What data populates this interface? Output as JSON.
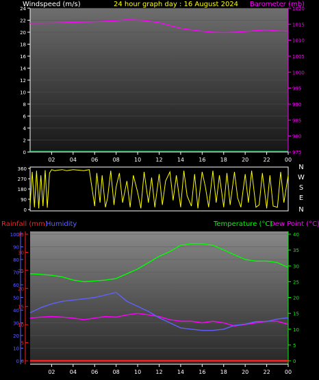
{
  "header": {
    "left_label": "Windspeed (m/s)",
    "center_label": "24 hour graph day : 16 August 2024",
    "right_label": "Barometer (mb)"
  },
  "direction_labels": [
    "N",
    "W",
    "S",
    "E",
    "N"
  ],
  "lower_header": {
    "rainfall_label": "Rainfall (mm)",
    "humidity_label": "Humidity",
    "temperature_label": "Temperature (°C)",
    "dewpoint_label": "Dew Point (°C)"
  },
  "colors": {
    "windspeed": "#00e060",
    "barometer": "#ff00ff",
    "direction": "#ffff00",
    "rainfall": "#ff2020",
    "humidity": "#6060ff",
    "temperature": "#00ff00",
    "dewpoint": "#ff00ff",
    "header_white": "#ffffff",
    "header_yellow": "#ffff00"
  },
  "chart_data": [
    {
      "type": "line",
      "x_tick_labels": [
        "02",
        "04",
        "06",
        "08",
        "10",
        "12",
        "14",
        "16",
        "18",
        "20",
        "22",
        "00"
      ],
      "left_axis": {
        "ticks": [
          "0",
          "2",
          "4",
          "6",
          "8",
          "10",
          "12",
          "14",
          "16",
          "18",
          "20",
          "22",
          "24"
        ],
        "ylim": [
          0,
          24
        ]
      },
      "right_axis": {
        "ticks": [
          "975",
          "980",
          "985",
          "990",
          "995",
          "1000",
          "1005",
          "1010",
          "1015",
          "1020"
        ],
        "ylim": [
          975,
          1020
        ]
      },
      "series": [
        {
          "name": "Windspeed (m/s)",
          "axis": "left",
          "hour": [
            0,
            24
          ],
          "value": [
            0.1,
            0.1
          ]
        },
        {
          "name": "Barometer (mb)",
          "axis": "right",
          "hour": [
            0,
            2,
            4,
            6,
            8,
            9,
            10,
            11,
            12,
            13,
            14,
            15,
            16,
            17,
            18,
            19,
            20,
            21,
            22,
            23,
            24
          ],
          "value": [
            1015.3,
            1015.4,
            1015.6,
            1015.8,
            1016.1,
            1016.4,
            1016.3,
            1016.0,
            1015.5,
            1014.6,
            1013.7,
            1013.2,
            1012.8,
            1012.5,
            1012.4,
            1012.5,
            1012.7,
            1013.0,
            1013.2,
            1012.9,
            1012.8
          ]
        }
      ]
    },
    {
      "type": "line",
      "x_tick_labels": [
        "02",
        "04",
        "06",
        "08",
        "10",
        "12",
        "14",
        "16",
        "18",
        "20",
        "22",
        "00"
      ],
      "left_axis": {
        "ticks": [
          "0",
          "90",
          "180",
          "270",
          "360"
        ],
        "ylim": [
          0,
          360
        ]
      },
      "series": [
        {
          "name": "Wind direction",
          "axis": "left",
          "hour": [
            0,
            0.2,
            0.4,
            0.6,
            0.8,
            1.0,
            1.2,
            1.4,
            1.6,
            1.8,
            2.0,
            2.3,
            2.6,
            3.0,
            3.4,
            3.7,
            4.0,
            4.5,
            5.0,
            5.5,
            6.0,
            6.2,
            6.5,
            6.7,
            7.0,
            7.2,
            7.5,
            7.8,
            8.0,
            8.3,
            8.6,
            9.0,
            9.3,
            9.6,
            10.0,
            10.3,
            10.6,
            11.0,
            11.3,
            11.6,
            12.0,
            12.3,
            12.6,
            13.0,
            13.3,
            13.6,
            14.0,
            14.3,
            14.6,
            15.0,
            15.3,
            15.6,
            16.0,
            16.3,
            16.6,
            17.0,
            17.3,
            17.6,
            18.0,
            18.3,
            18.6,
            19.0,
            19.3,
            19.6,
            20.0,
            20.3,
            20.6,
            21.0,
            21.3,
            21.6,
            22.0,
            22.3,
            22.6,
            23.0,
            23.3,
            23.6,
            24.0
          ],
          "value": [
            40,
            330,
            20,
            340,
            10,
            300,
            30,
            345,
            15,
            320,
            350,
            340,
            345,
            350,
            340,
            345,
            350,
            345,
            340,
            350,
            30,
            320,
            60,
            300,
            20,
            100,
            340,
            40,
            200,
            320,
            60,
            250,
            20,
            300,
            150,
            10,
            330,
            60,
            280,
            20,
            310,
            40,
            250,
            330,
            80,
            300,
            20,
            340,
            120,
            30,
            310,
            10,
            330,
            200,
            20,
            340,
            60,
            300,
            20,
            320,
            40,
            330,
            100,
            20,
            310,
            60,
            340,
            20,
            40,
            320,
            10,
            300,
            30,
            20,
            330,
            60,
            300
          ]
        }
      ]
    },
    {
      "type": "line",
      "x_tick_labels": [
        "02",
        "04",
        "06",
        "08",
        "10",
        "12",
        "14",
        "16",
        "18",
        "20",
        "22",
        "00"
      ],
      "humidity_axis": {
        "ticks": [
          "0",
          "10",
          "20",
          "30",
          "40",
          "50",
          "60",
          "70",
          "80",
          "90",
          "100"
        ],
        "ylim": [
          0,
          100
        ]
      },
      "rainfall_axis": {
        "ticks": [
          "0",
          "5",
          "10",
          "15",
          "20",
          "25",
          "30",
          "35"
        ],
        "ylim": [
          0,
          35
        ]
      },
      "temperature_axis": {
        "ticks": [
          "0",
          "5",
          "10",
          "15",
          "20",
          "25",
          "30",
          "35",
          "40"
        ],
        "ylim": [
          0,
          40
        ]
      },
      "series": [
        {
          "name": "Temperature (°C)",
          "axis": "temperature",
          "hour": [
            0,
            1,
            2,
            3,
            4,
            5,
            6,
            7,
            8,
            9,
            10,
            11,
            12,
            13,
            14,
            15,
            16,
            17,
            18,
            19,
            20,
            21,
            22,
            23,
            24
          ],
          "value": [
            27.5,
            27.3,
            27.0,
            26.5,
            25.5,
            25.0,
            25.2,
            25.5,
            26.0,
            27.5,
            29.0,
            31.0,
            33.0,
            34.5,
            36.5,
            37.0,
            37.0,
            36.5,
            35.0,
            33.5,
            32.0,
            31.5,
            31.5,
            31.0,
            29.5
          ]
        },
        {
          "name": "Dew Point (°C)",
          "axis": "temperature",
          "hour": [
            0,
            1,
            2,
            3,
            4,
            5,
            6,
            7,
            8,
            9,
            10,
            11,
            12,
            13,
            14,
            15,
            16,
            17,
            18,
            19,
            20,
            21,
            22,
            23,
            24
          ],
          "value": [
            13.5,
            13.8,
            14.0,
            13.8,
            13.5,
            13.0,
            13.5,
            14.0,
            13.8,
            14.5,
            15.0,
            14.5,
            14.0,
            13.0,
            12.5,
            12.5,
            12.0,
            12.5,
            12.0,
            11.0,
            11.5,
            12.0,
            12.5,
            12.5,
            11.5
          ]
        },
        {
          "name": "Humidity",
          "axis": "humidity",
          "hour": [
            0,
            1,
            2,
            3,
            4,
            5,
            6,
            7,
            8,
            9,
            10,
            11,
            12,
            13,
            14,
            15,
            16,
            17,
            18,
            19,
            20,
            21,
            22,
            23,
            24
          ],
          "value": [
            38,
            42,
            45,
            47,
            48,
            49,
            50,
            52,
            54,
            47,
            43,
            39,
            34,
            30,
            26,
            25,
            24,
            24,
            25,
            28,
            29,
            31,
            31,
            33,
            34
          ]
        },
        {
          "name": "Rainfall (mm)",
          "axis": "rainfall",
          "hour": [
            0,
            24
          ],
          "value": [
            0,
            0
          ]
        }
      ]
    }
  ]
}
